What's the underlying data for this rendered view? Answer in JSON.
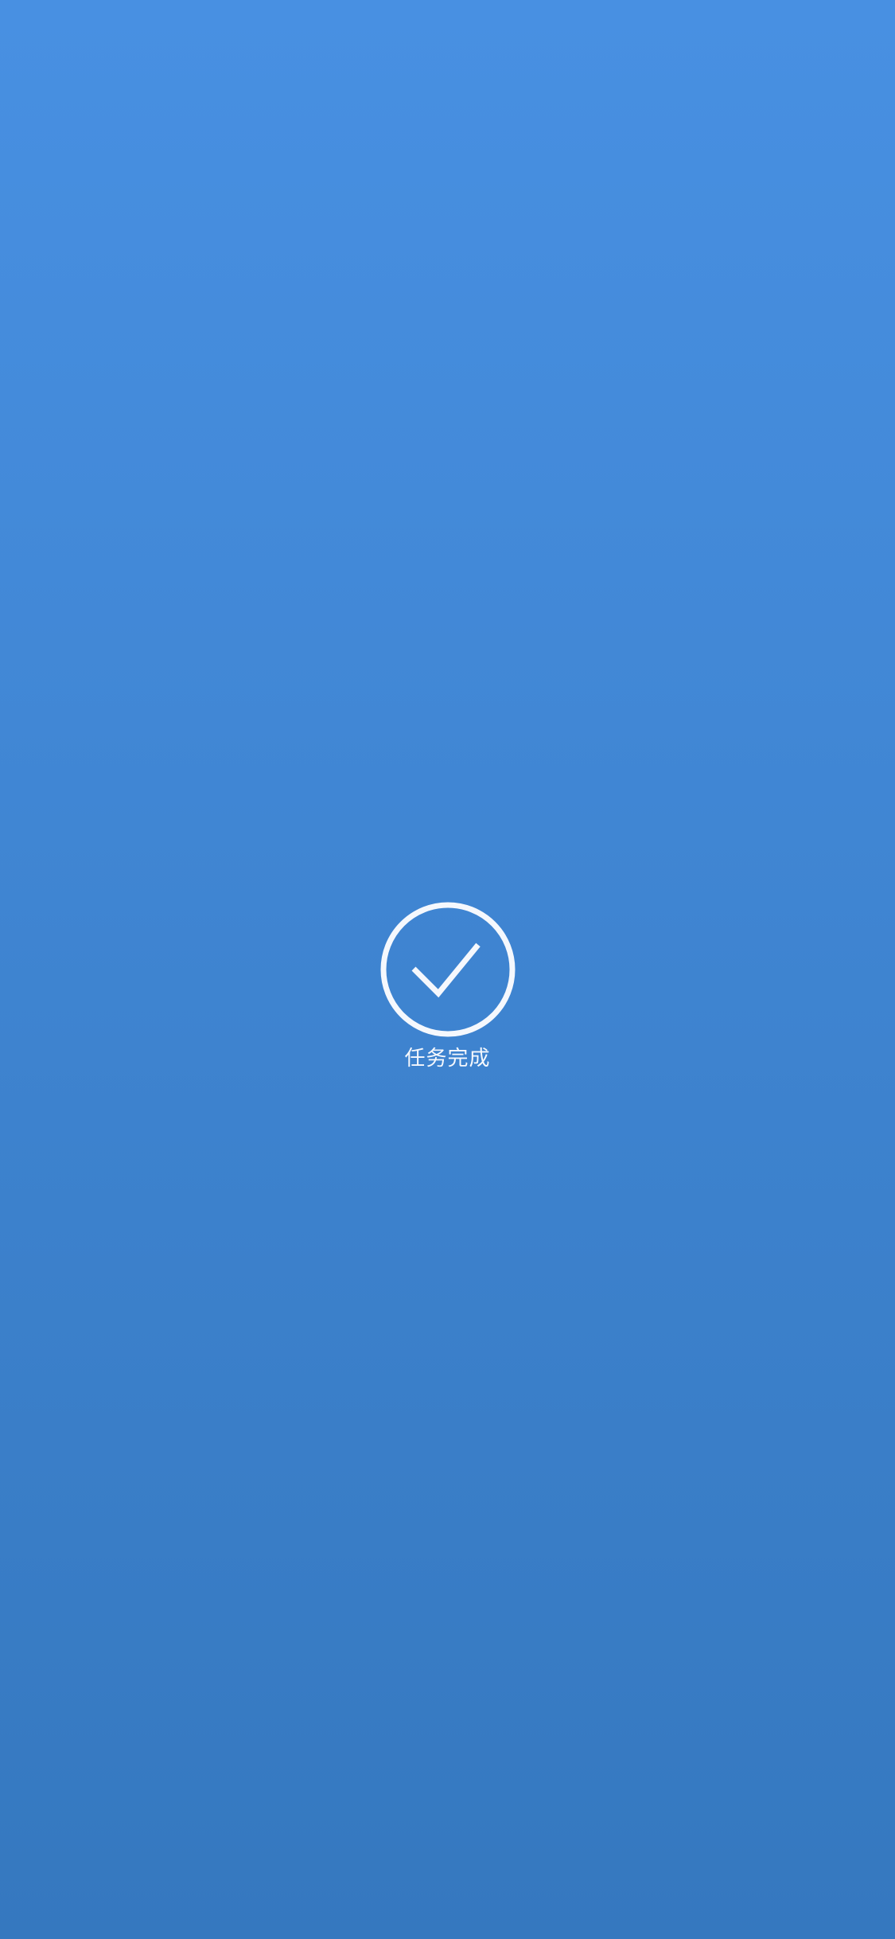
{
  "colors": {
    "background_top": "#4890E2",
    "background_bottom": "#3578BF",
    "foreground": "#F5F8FD"
  },
  "success": {
    "icon": "check-circle-icon",
    "message": "任务完成"
  }
}
